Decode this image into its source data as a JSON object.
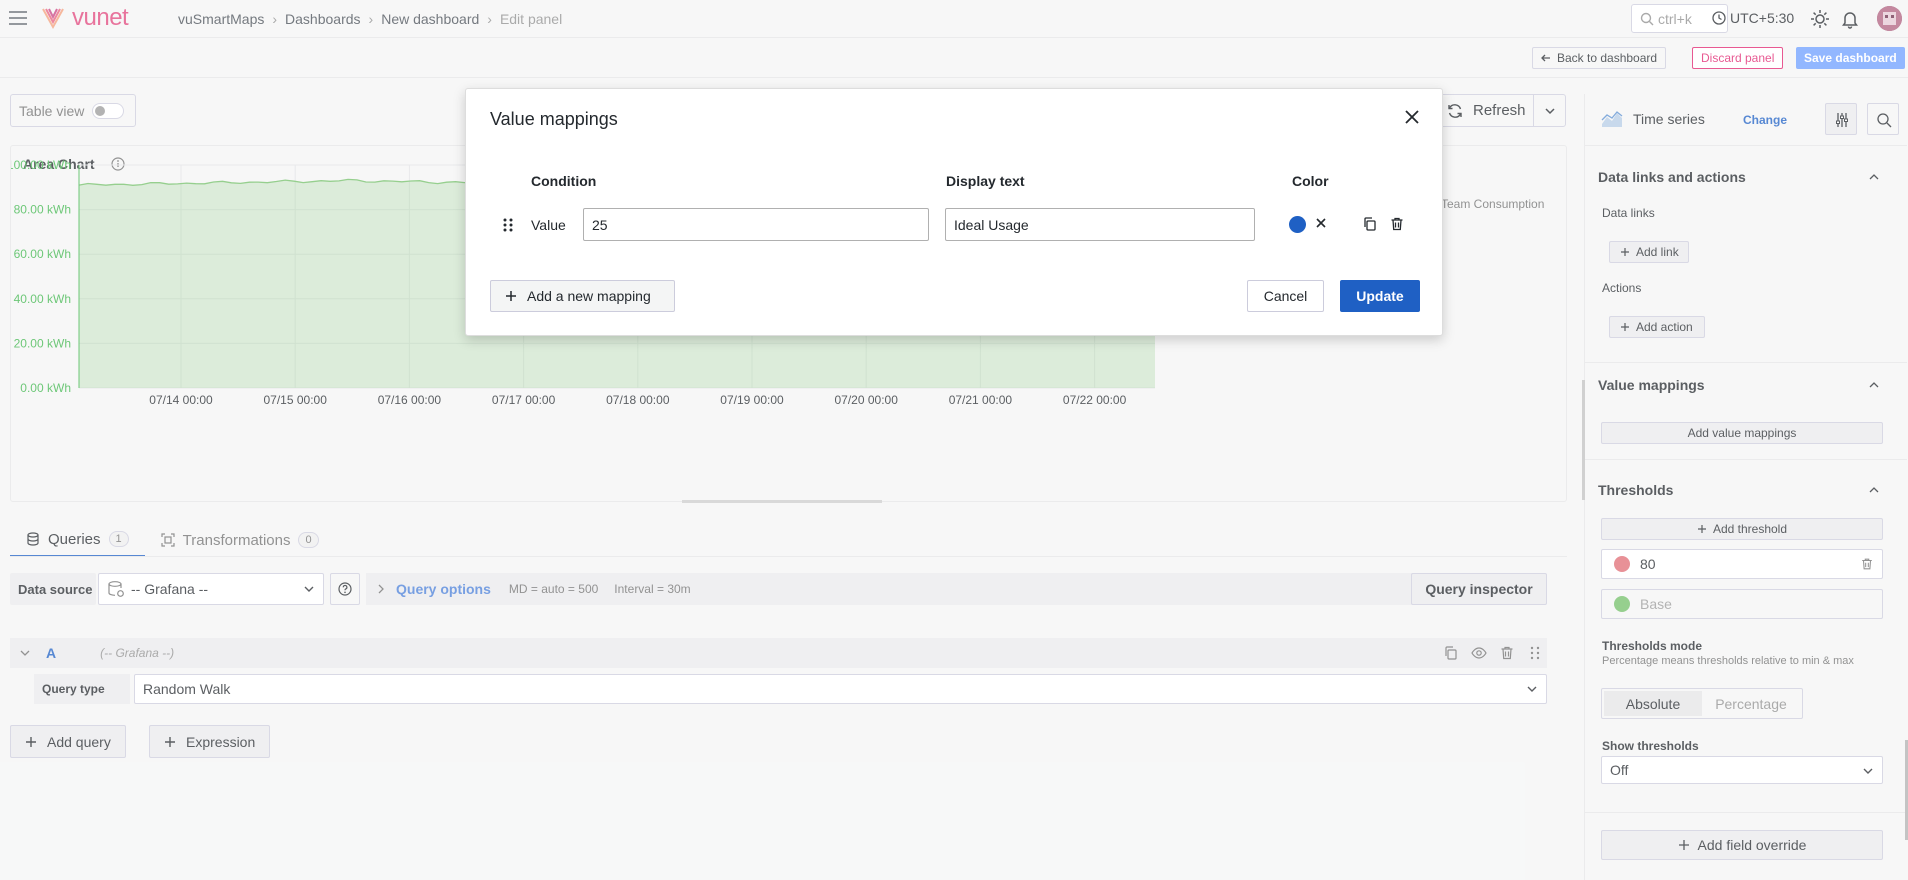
{
  "header": {
    "logo_text": "vunet",
    "breadcrumbs": [
      "vuSmartMaps",
      "Dashboards",
      "New dashboard",
      "Edit panel"
    ],
    "search_placeholder": "ctrl+k",
    "timezone": "UTC+5:30"
  },
  "toolbar": {
    "back_label": "Back to dashboard",
    "discard_label": "Discard panel",
    "save_label": "Save dashboard",
    "table_view_label": "Table view",
    "refresh_label": "Refresh"
  },
  "panel": {
    "title": "Area Chart",
    "legend_label": "Team Consumption"
  },
  "chart_data": {
    "type": "area",
    "title": "Area Chart",
    "x": [
      "07/14 00:00",
      "07/15 00:00",
      "07/16 00:00",
      "07/17 00:00",
      "07/18 00:00",
      "07/19 00:00",
      "07/20 00:00",
      "07/21 00:00",
      "07/22 00:00"
    ],
    "yticks": [
      "0.00 kWh",
      "20.00 kWh",
      "40.00 kWh",
      "60.00 kWh",
      "80.00 kWh",
      "100.00 kWh"
    ],
    "ylim": [
      0,
      100
    ],
    "series": [
      {
        "name": "Team Consumption",
        "values": [
          91,
          92,
          93,
          92,
          91,
          90,
          90,
          91,
          91
        ]
      }
    ],
    "grid": true,
    "color": "#73bf69"
  },
  "queries": {
    "tabs": [
      {
        "label": "Queries",
        "count": "1"
      },
      {
        "label": "Transformations",
        "count": "0"
      }
    ],
    "data_source_label": "Data source",
    "data_source_value": "-- Grafana --",
    "query_options_label": "Query options",
    "md_label": "MD = auto = 500",
    "interval_label": "Interval = 30m",
    "inspector_label": "Query inspector",
    "row_letter": "A",
    "row_ds": "(-- Grafana --)",
    "query_type_label": "Query type",
    "query_type_value": "Random Walk",
    "add_query_label": "Add query",
    "expression_label": "Expression"
  },
  "sidebar": {
    "viz_name": "Time series",
    "change_label": "Change",
    "data_links_section": "Data links and actions",
    "data_links_label": "Data links",
    "add_link_label": "Add link",
    "actions_label": "Actions",
    "add_action_label": "Add action",
    "value_mappings_section": "Value mappings",
    "add_value_mappings_label": "Add value mappings",
    "thresholds_section": "Thresholds",
    "add_threshold_label": "Add threshold",
    "threshold_value": "80",
    "threshold_base": "Base",
    "thresholds_mode_title": "Thresholds mode",
    "thresholds_mode_desc": "Percentage means thresholds relative to min & max",
    "mode_absolute": "Absolute",
    "mode_percentage": "Percentage",
    "show_thresholds_title": "Show thresholds",
    "show_thresholds_value": "Off",
    "add_field_override_label": "Add field override",
    "threshold_red": "#e06c75",
    "threshold_green": "#73bf69"
  },
  "modal": {
    "title": "Value mappings",
    "col_condition": "Condition",
    "col_display": "Display text",
    "col_color": "Color",
    "row_condition": "Value",
    "row_value": "25",
    "row_display": "Ideal Usage",
    "row_color": "#1f60c4",
    "add_mapping_label": "Add a new mapping",
    "cancel_label": "Cancel",
    "update_label": "Update"
  }
}
